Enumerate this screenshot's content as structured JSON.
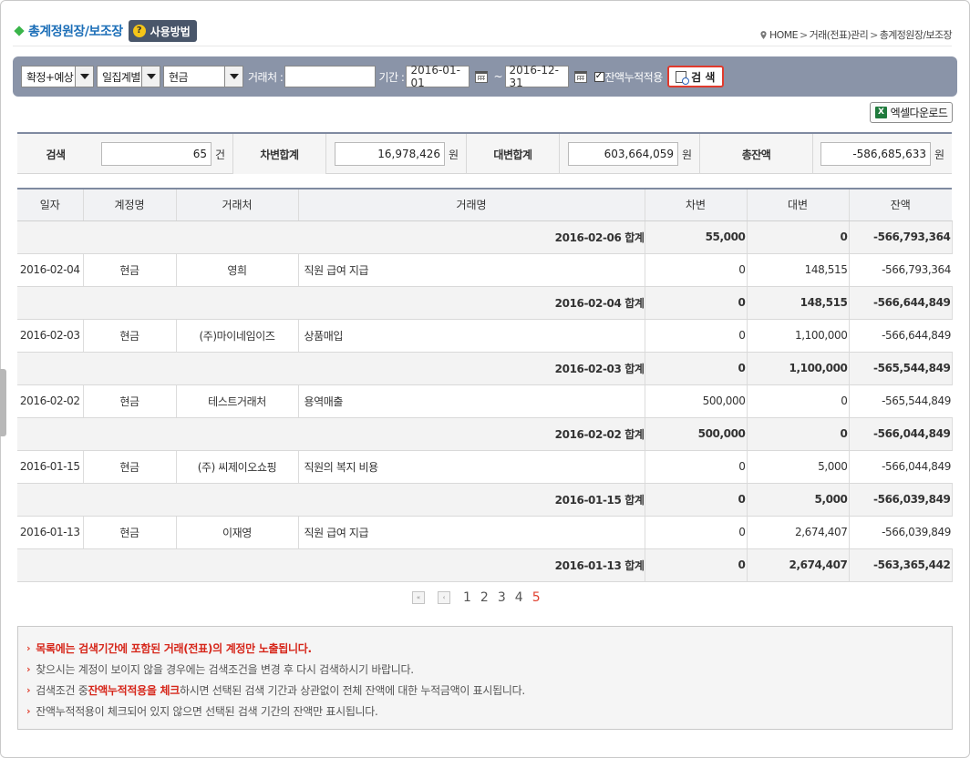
{
  "header": {
    "title": "총계정원장/보조장",
    "help_label": "사용방법",
    "breadcrumb": [
      "HOME",
      "거래(전표)관리",
      "총계정원장/보조장"
    ]
  },
  "search": {
    "type_select": "확정+예상",
    "group_select": "일집계별",
    "account_select": "현금",
    "vendor_label": "거래처 :",
    "vendor_value": "",
    "period_label": "기간 :",
    "date_from": "2016-01-01",
    "date_to": "2016-12-31",
    "tilde": "~",
    "cumulative_label": "잔액누적적용",
    "cumulative_checked": true,
    "search_button": "검 색"
  },
  "excel_button": "엑셀다운로드",
  "summary": {
    "count_label": "검색",
    "count_value": "65",
    "count_unit": "건",
    "debit_label": "차변합계",
    "debit_value": "16,978,426",
    "debit_unit": "원",
    "credit_label": "대변합계",
    "credit_value": "603,664,059",
    "credit_unit": "원",
    "balance_label": "총잔액",
    "balance_value": "-586,685,633",
    "balance_unit": "원"
  },
  "table": {
    "columns": [
      "일자",
      "계정명",
      "거래처",
      "거래명",
      "차변",
      "대변",
      "잔액"
    ],
    "rows": [
      {
        "type": "sum",
        "label": "2016-02-06 합계",
        "debit": "55,000",
        "credit": "0",
        "balance": "-566,793,364"
      },
      {
        "type": "item",
        "date": "2016-02-04",
        "account": "현금",
        "vendor": "영희",
        "desc": "직원 급여 지급",
        "debit": "0",
        "credit": "148,515",
        "balance": "-566,793,364"
      },
      {
        "type": "sum",
        "label": "2016-02-04 합계",
        "debit": "0",
        "credit": "148,515",
        "balance": "-566,644,849"
      },
      {
        "type": "item",
        "date": "2016-02-03",
        "account": "현금",
        "vendor": "(주)마이네임이즈",
        "desc": "상품매입",
        "debit": "0",
        "credit": "1,100,000",
        "balance": "-566,644,849"
      },
      {
        "type": "sum",
        "label": "2016-02-03 합계",
        "debit": "0",
        "credit": "1,100,000",
        "balance": "-565,544,849"
      },
      {
        "type": "item",
        "date": "2016-02-02",
        "account": "현금",
        "vendor": "테스트거래처",
        "desc": "용역매출",
        "debit": "500,000",
        "credit": "0",
        "balance": "-565,544,849"
      },
      {
        "type": "sum",
        "label": "2016-02-02 합계",
        "debit": "500,000",
        "credit": "0",
        "balance": "-566,044,849"
      },
      {
        "type": "item",
        "date": "2016-01-15",
        "account": "현금",
        "vendor": "(주) 씨제이오쇼핑",
        "desc": "직원의 복지 비용",
        "debit": "0",
        "credit": "5,000",
        "balance": "-566,044,849"
      },
      {
        "type": "sum",
        "label": "2016-01-15 합계",
        "debit": "0",
        "credit": "5,000",
        "balance": "-566,039,849"
      },
      {
        "type": "item",
        "date": "2016-01-13",
        "account": "현금",
        "vendor": "이재영",
        "desc": "직원 급여 지급",
        "debit": "0",
        "credit": "2,674,407",
        "balance": "-566,039,849"
      },
      {
        "type": "sum",
        "label": "2016-01-13 합계",
        "debit": "0",
        "credit": "2,674,407",
        "balance": "-563,365,442"
      }
    ]
  },
  "pagination": {
    "pages": [
      "1",
      "2",
      "3",
      "4",
      "5"
    ],
    "current": "5"
  },
  "notice": {
    "line1": "목록에는 검색기간에 포함된 거래(전표)의 계정만 노출됩니다.",
    "line2": "찾으시는 계정이 보이지 않을 경우에는 검색조건을 변경 후 다시 검색하시기 바랍니다.",
    "line3_pre": "검색조건 중 ",
    "line3_hl": "잔액누적적용을 체크",
    "line3_post": "하시면 선택된 검색 기간과 상관없이 전체 잔액에 대한 누적금액이 표시됩니다.",
    "line4": "잔액누적적용이 체크되어 있지 않으면 선택된 검색 기간의 잔액만 표시됩니다."
  },
  "colors": {
    "accent": "#1d6fb8",
    "search_bar": "#8a94a8",
    "highlight_red": "#d6261a",
    "account_link": "#2a63b8"
  }
}
